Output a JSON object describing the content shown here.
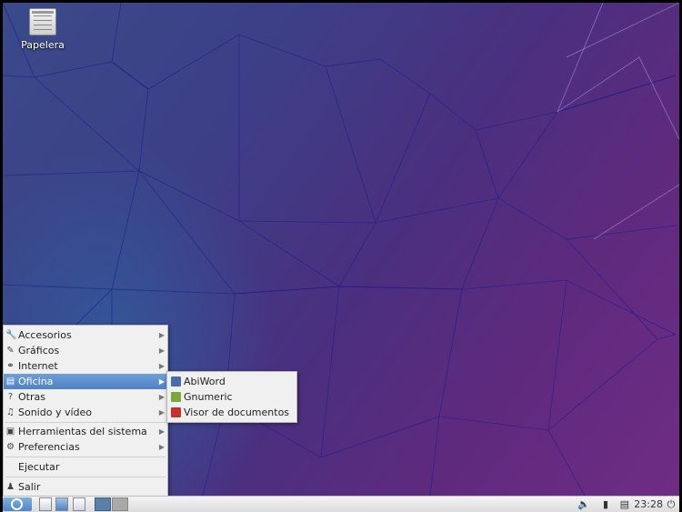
{
  "desktop": {
    "icons": [
      {
        "label": "Papelera",
        "icon": "trash-icon"
      }
    ]
  },
  "menu": {
    "items": [
      {
        "label": "Accesorios",
        "icon": "accessories-icon",
        "submenu": true
      },
      {
        "label": "Gráficos",
        "icon": "graphics-icon",
        "submenu": true
      },
      {
        "label": "Internet",
        "icon": "internet-globe-icon",
        "submenu": true
      },
      {
        "label": "Oficina",
        "icon": "office-icon",
        "submenu": true,
        "selected": true
      },
      {
        "label": "Otras",
        "icon": "other-icon",
        "submenu": true
      },
      {
        "label": "Sonido y vídeo",
        "icon": "sound-video-icon",
        "submenu": true
      },
      {
        "label": "Herramientas del sistema",
        "icon": "system-tools-icon",
        "submenu": true
      },
      {
        "label": "Preferencias",
        "icon": "preferences-gear-icon",
        "submenu": true
      },
      {
        "label": "Ejecutar",
        "icon": "",
        "submenu": false
      },
      {
        "label": "Salir",
        "icon": "logout-icon",
        "submenu": false
      }
    ]
  },
  "submenu": {
    "items": [
      {
        "label": "AbiWord",
        "icon": "abiword-icon",
        "color": "#4a6fa8"
      },
      {
        "label": "Gnumeric",
        "icon": "gnumeric-icon",
        "color": "#7aa83a"
      },
      {
        "label": "Visor de documentos",
        "icon": "pdf-viewer-icon",
        "color": "#c8312a"
      }
    ]
  },
  "panel": {
    "clock": "23:28",
    "tray_icons": [
      "volume-icon",
      "battery-icon",
      "network-icon",
      "power-icon"
    ]
  },
  "colors": {
    "selection": "#4f82c4",
    "menu_bg": "#f0f0f0",
    "panel_bg": "#e6e6e6"
  }
}
